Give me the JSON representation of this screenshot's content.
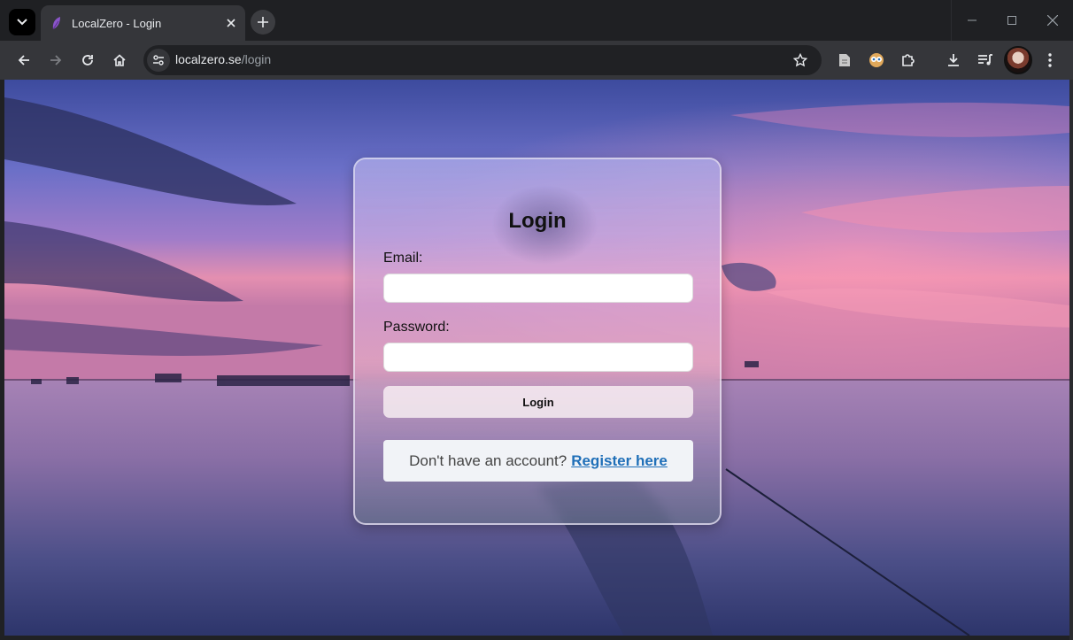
{
  "browser": {
    "tab": {
      "title": "LocalZero - Login"
    },
    "address": {
      "host": "localzero.se",
      "path": "/login"
    }
  },
  "page": {
    "heading": "Login",
    "email_label": "Email:",
    "email_value": "",
    "password_label": "Password:",
    "password_value": "",
    "submit_label": "Login",
    "register_prompt": "Don't have an account?",
    "register_link": "Register here"
  },
  "colors": {
    "link": "#1f6fb8",
    "browser_chrome": "#35363a",
    "favicon": "#8a55c9"
  }
}
